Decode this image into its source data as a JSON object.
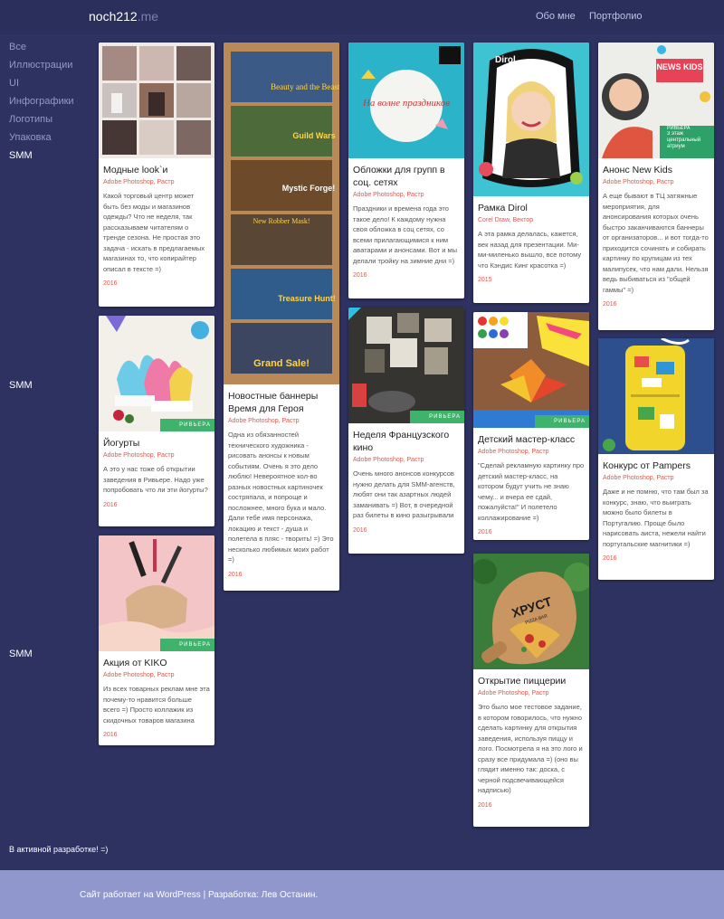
{
  "header": {
    "logo_main": "noch212",
    "logo_suffix": ".me",
    "nav": [
      "Обо мне",
      "Портфолио"
    ]
  },
  "sidebar": {
    "items": [
      "Все",
      "Иллюстрации",
      "UI",
      "Инфографики",
      "Логотипы",
      "Упаковка",
      "SMM"
    ],
    "active": "SMM",
    "repeat_labels": [
      "SMM",
      "SMM"
    ]
  },
  "cards": [
    {
      "title": "Модные look`и",
      "tags": "Adobe Photoshop, Растр",
      "desc": "Какой торговый центр может быть без моды и магазинов одежды? Что не неделя, так рассказываем читателям о тренде сезона. Не простая это задача - искать в предлагаемых магазинах то, что копирайтер описал в тексте =)",
      "year": "2016"
    },
    {
      "title": "Йогурты",
      "tags": "Adobe Photoshop, Растр",
      "desc": "А это у нас тоже об открытии заведения в Ривьере. Надо уже попробовать что ли эти йогурты?",
      "year": "2016"
    },
    {
      "title": "Акция от KIKO",
      "tags": "Adobe Photoshop, Растр",
      "desc": "Из всех товарных реклам мне эта почему-то нравится больше всего =) Просто коллажик из скидочных товаров магазина",
      "year": "2016"
    },
    {
      "title": "Новостные баннеры Время для Героя",
      "tags": "Adobe Photoshop, Растр",
      "desc": "Одна из обязанностей технического художника - рисовать анонсы к новым событиям. Очень я это дело люблю! Невероятное кол-во разных новостных картиночек состряпала, и попроще и посложнее, много бука и мало. Дали тебе имя персонажа, локацию и текст - душа и полетела в пляс - творить! =) Это несколько любимых моих работ =)",
      "year": "2016"
    },
    {
      "title": "Обложки для групп в соц. сетях",
      "tags": "Adobe Photoshop, Растр",
      "desc": "Праздники и времена года это такое дело! К каждому нужна своя обложка в соц сетях, со всеми прилагающимися к ним аватарами и анонсами. Вот и мы делали тройку на зимние дни =)",
      "year": "2016"
    },
    {
      "title": "Неделя Французского кино",
      "tags": "Adobe Photoshop, Растр",
      "desc": "Очень много анонсов конкурсов нужно делать для SMM-агенств, любят они так азартных людей заманивать =) Вот, в очередной раз билеты в кино разыгрывали",
      "year": "2016"
    },
    {
      "title": "Рамка Dirol",
      "tags": "Corel Draw, Вектор",
      "desc": "А эта рамка делалась, кажется, век назад для презентации. Ми-ми-миленько вышло, все потому что Кэндис Кинг красотка =)",
      "year": "2015"
    },
    {
      "title": "Детский мастер-класс",
      "tags": "Adobe Photoshop, Растр",
      "desc": "\"Сделай рекламную картинку про детский мастер-класс, на котором будут учить не знаю чему... и вчера ее сдай, пожалуйста!\" И полетело коллажирование =)",
      "year": "2016"
    },
    {
      "title": "Открытие пиццерии",
      "tags": "Adobe Photoshop, Растр",
      "desc": "Это было мое тестовое задание, в котором говорилось, что нужно сделать картинку для открытия заведения, используя пиццу и лого. Посмотрела я на это лого и сразу все придумала =) (оно вы глядит именно так: доска, с черной подсвечивающейся надписью)",
      "year": "2016"
    },
    {
      "title": "Анонс New Kids",
      "tags": "Adobe Photoshop, Растр",
      "desc": "А еще бывают в ТЦ затяжные мероприятия, для анонсирования которых очень быстро заканчиваются баннеры от организаторов... и вот тогда-то приходится сочинять и собирать картинку по крупицам из тех малипусек, что нам дали. Нельзя ведь выбиваться из \"общей гаммы\" =)",
      "year": "2016"
    },
    {
      "title": "Конкурс от Pampers",
      "tags": "Adobe Photoshop, Растр",
      "desc": "Даже и не помню, что там был за конкурс, знаю, что выиграть можно было билеты в Португалию. Проще было нарисовать аиста, нежели найти португальские магнитики =)",
      "year": "2016"
    }
  ],
  "thumb_text": {
    "banners": [
      "Beauty and the Beasts",
      "Guild Wars",
      "Mystic Forge!",
      "New Robber Mask!",
      "Treasure Hunt!",
      "Grand Sale!"
    ],
    "winter": "На волне праздников",
    "dirol": "Dirol",
    "newkids": "NEWS KIDS",
    "floor": "3 этаж центральный атриум",
    "brand": "РИВЬЕРА",
    "pizza": "ХРУСТ",
    "pizza_sub": "PIZZA BAR"
  },
  "footer": {
    "dev_note": "В активной разработке! =)",
    "credits": "Сайт работает на WordPress | Разработка: Лев Останин."
  },
  "colors": {
    "background": "#2e3261",
    "footer": "#8f97cc",
    "accent": "#e2574c"
  }
}
